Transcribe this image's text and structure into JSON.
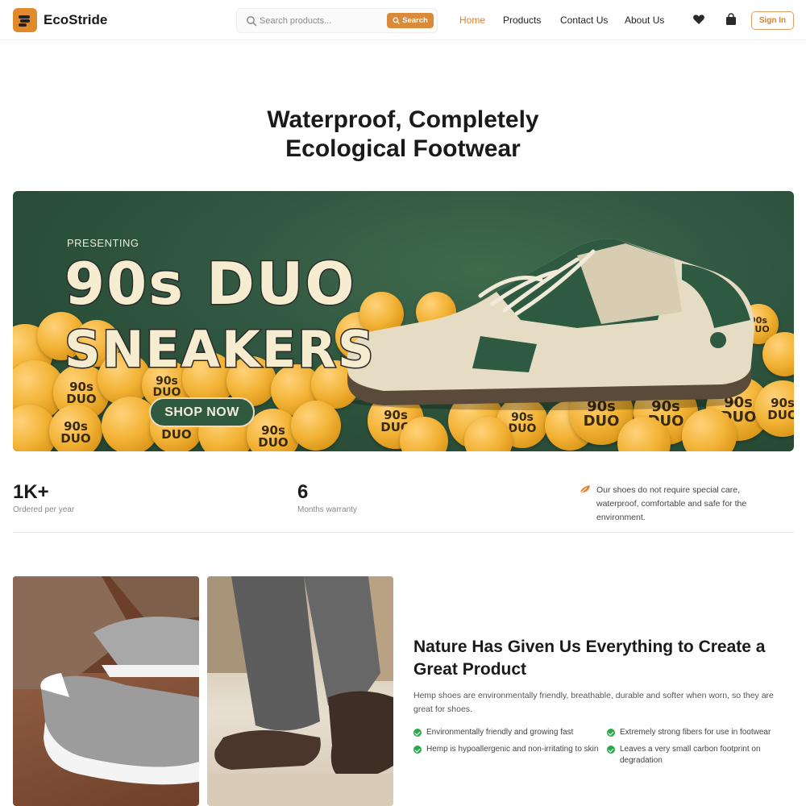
{
  "header": {
    "brand": "EcoStride",
    "search": {
      "placeholder": "Search products...",
      "button_label": "Search"
    },
    "nav": [
      {
        "label": "Home",
        "active": true
      },
      {
        "label": "Products",
        "active": false
      },
      {
        "label": "Contact Us",
        "active": false
      },
      {
        "label": "About Us",
        "active": false
      }
    ],
    "icons": [
      "heart-icon",
      "shopping-bag-icon"
    ],
    "signin_label": "Sign In"
  },
  "hero": {
    "title_line1": "Waterproof, Completely",
    "title_line2": "Ecological Footwear"
  },
  "banner": {
    "kicker": "PRESENTING",
    "headline_line1": "90s DUO",
    "headline_line2": "SNEAKERS",
    "ball_text": "90s DUO",
    "cta_label": "SHOP NOW"
  },
  "stats": [
    {
      "value": "1K+",
      "label": "Ordered per year"
    },
    {
      "value": "6",
      "label": "Months warranty"
    }
  ],
  "note": "Our shoes do not require special care, waterproof, comfortable and safe for the environment.",
  "feature": {
    "title": "Nature Has Given Us Everything to Create a Great Product",
    "description": "Hemp shoes are environmentally friendly, breathable, durable and softer when worn, so they are great for shoes.",
    "checklist": [
      "Environmentally friendly and growing fast",
      "Extremely strong fibers for use in footwear",
      "Hemp is hypoallergenic and non-irritating to skin",
      "Leaves a very small carbon footprint on degradation"
    ]
  },
  "colors": {
    "accent": "#d9822b",
    "banner_green": "#2f5640",
    "check_green": "#2aa84a"
  }
}
